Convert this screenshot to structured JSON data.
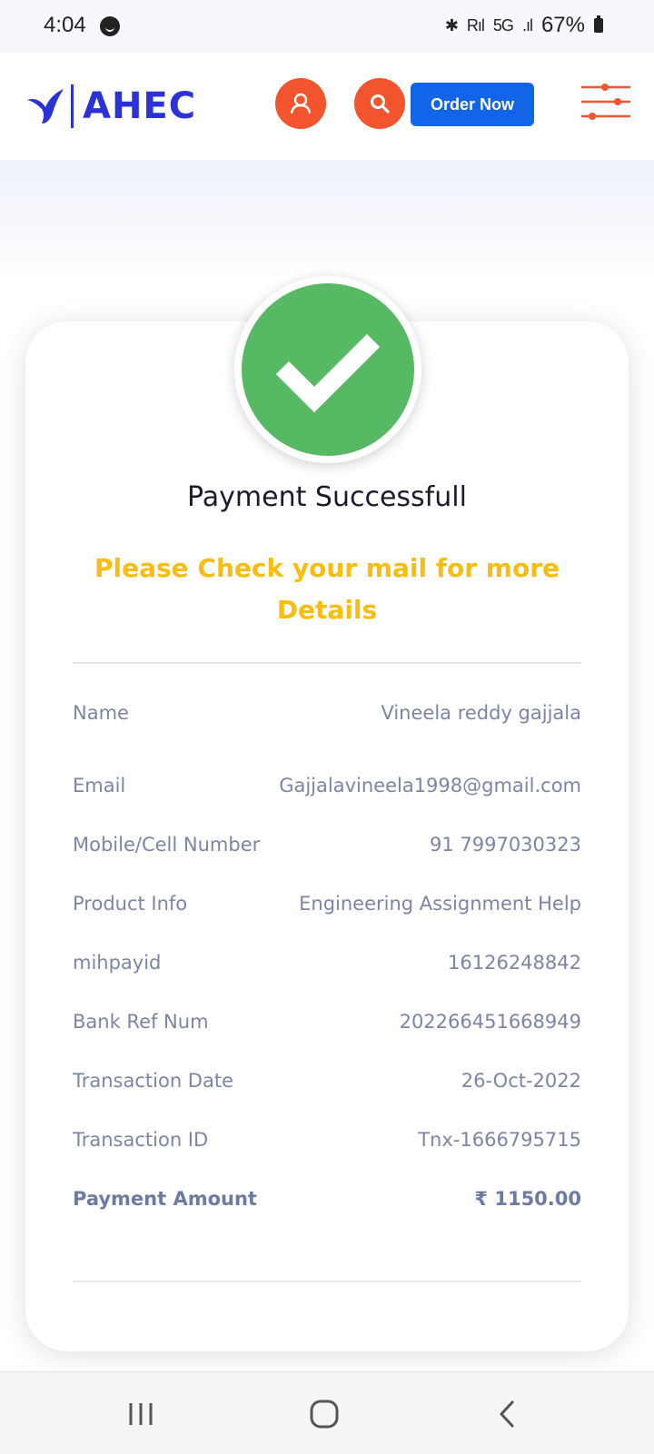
{
  "status_bar": {
    "time": "4:04",
    "signal_text": "R",
    "network": "5G",
    "battery": "67%"
  },
  "header": {
    "logo_text": "AHEC",
    "order_button": "Order Now",
    "icons": [
      "user-icon",
      "search-icon",
      "filter-sliders-icon"
    ],
    "accent_color": "#f2542d",
    "brand_color": "#2b33d6"
  },
  "payment": {
    "title": "Payment Successfull",
    "note": "Please Check your mail for more Details",
    "success_color": "#58b964",
    "rows": [
      {
        "label": "Name",
        "value": "Vineela reddy gajjala"
      },
      {
        "label": "Email",
        "value": "Gajjalavineela1998@gmail.com"
      },
      {
        "label": "Mobile/Cell Number",
        "value": "91 7997030323"
      },
      {
        "label": "Product Info",
        "value": "Engineering Assignment Help"
      },
      {
        "label": "mihpayid",
        "value": "16126248842"
      },
      {
        "label": "Bank Ref Num",
        "value": "202266451668949"
      },
      {
        "label": "Transaction Date",
        "value": "26-Oct-2022"
      },
      {
        "label": "Transaction ID",
        "value": "Tnx-1666795715"
      },
      {
        "label": "Payment Amount",
        "value": "₹ 1150.00"
      }
    ]
  },
  "nav_bar": {
    "icons": [
      "recents-icon",
      "home-icon",
      "back-icon"
    ]
  }
}
